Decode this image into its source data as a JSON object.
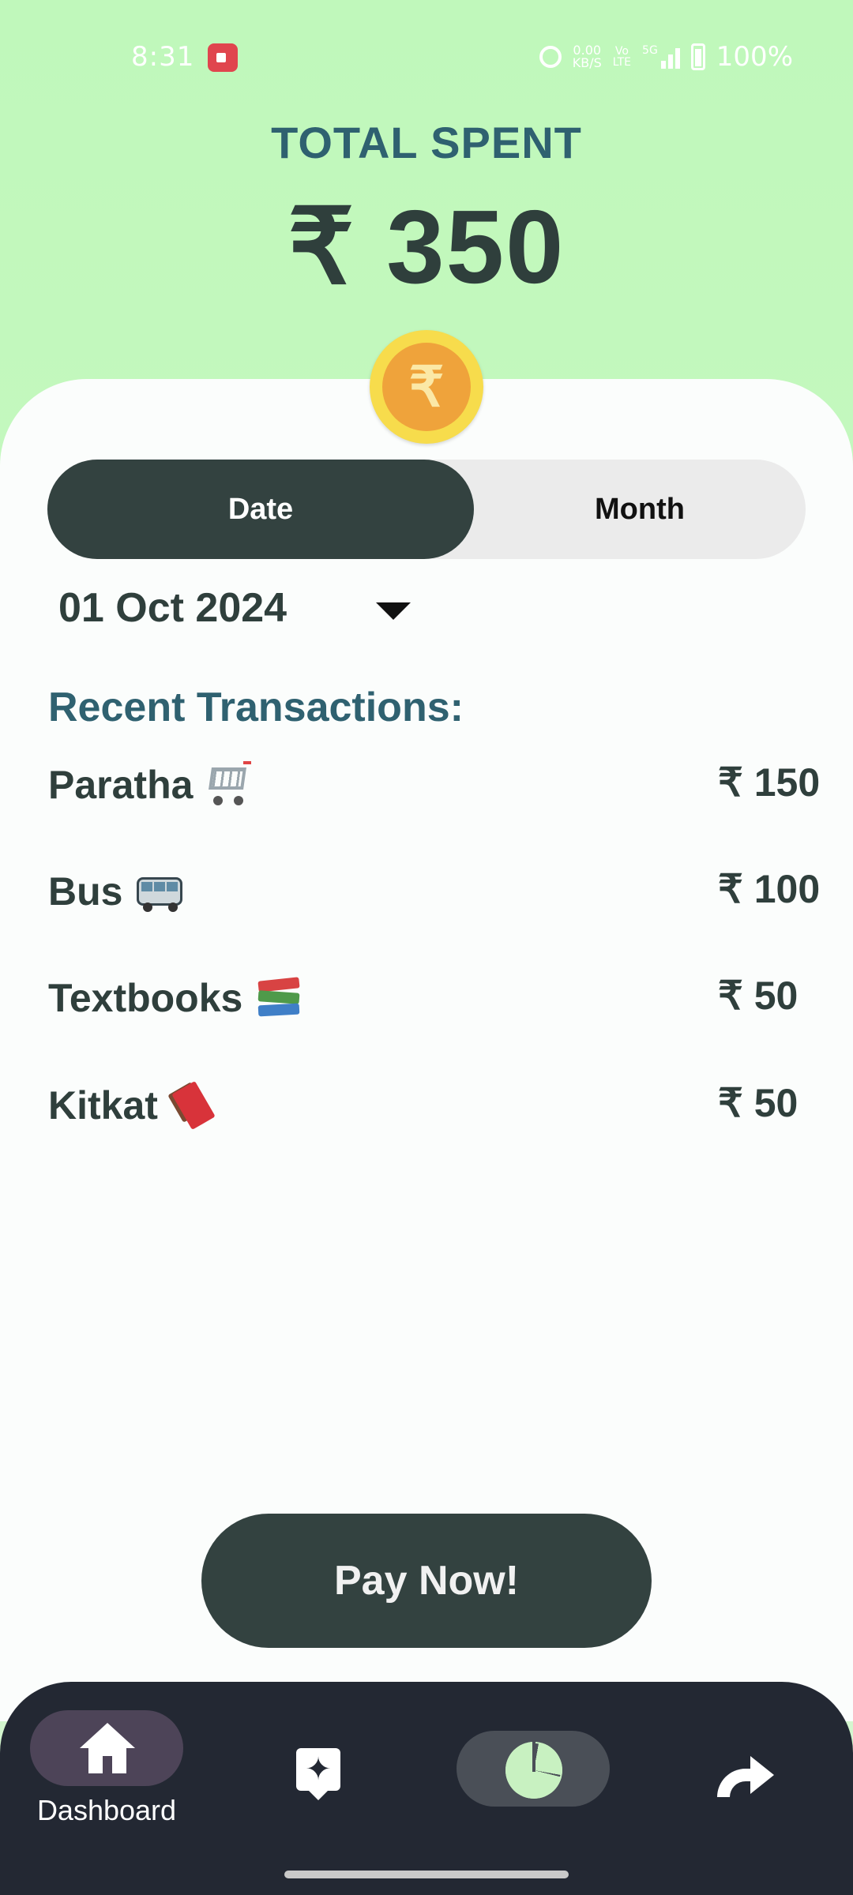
{
  "status_bar": {
    "time": "8:31",
    "net_speed": "0.00",
    "net_speed_unit": "KB/S",
    "network_type_top": "Vo",
    "network_type_bottom": "LTE",
    "signal_label": "5G",
    "battery": "100%",
    "icons": [
      "screen-record-icon",
      "alarm-icon",
      "signal-icon",
      "battery-icon"
    ]
  },
  "summary": {
    "label": "TOTAL SPENT",
    "amount": "₹ 350",
    "coin_symbol": "₹"
  },
  "filter_toggle": {
    "options": [
      "Date",
      "Month"
    ],
    "selected": "Date"
  },
  "date_picker": {
    "value": "01 Oct 2024"
  },
  "transactions": {
    "heading": "Recent Transactions:",
    "items": [
      {
        "name": "Paratha",
        "icon": "shopping-cart-icon",
        "amount": "₹ 150"
      },
      {
        "name": "Bus",
        "icon": "bus-icon",
        "amount": "₹ 100"
      },
      {
        "name": "Textbooks",
        "icon": "books-icon",
        "amount": "₹ 50"
      },
      {
        "name": "Kitkat",
        "icon": "chocolate-bar-icon",
        "amount": "₹ 50"
      }
    ]
  },
  "pay_button": {
    "label": "Pay Now!"
  },
  "bottom_nav": {
    "items": [
      {
        "label": "Dashboard",
        "icon": "home-icon",
        "active": true
      },
      {
        "label": "",
        "icon": "ai-sparkle-icon",
        "active": false
      },
      {
        "label": "",
        "icon": "pie-chart-icon",
        "active": false
      },
      {
        "label": "",
        "icon": "share-icon",
        "active": false
      }
    ]
  },
  "colors": {
    "header_bg": "#c0f8bb",
    "primary_dark": "#334240",
    "heading_teal": "#2f6170",
    "nav_bg": "#232833",
    "coin_outer": "#f7dc4c",
    "coin_inner": "#efa33b"
  }
}
